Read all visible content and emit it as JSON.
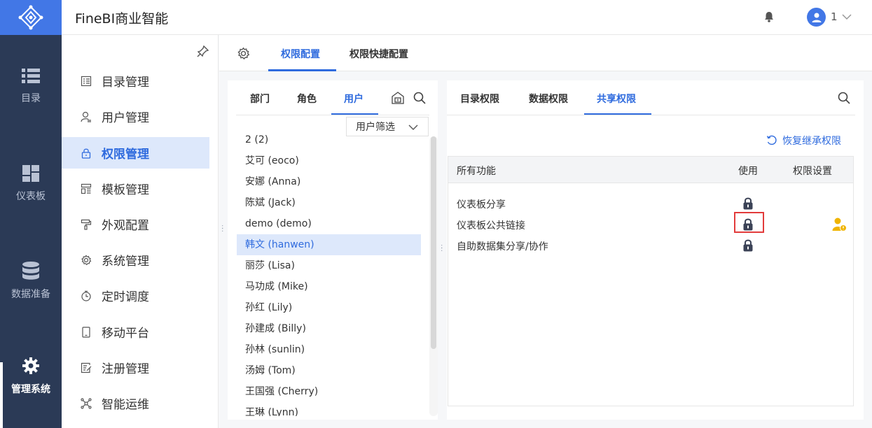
{
  "app": {
    "title": "FineBI商业智能",
    "user": "1"
  },
  "rail": [
    {
      "label": "目录",
      "icon": "list-icon"
    },
    {
      "label": "仪表板",
      "icon": "dashboard-icon"
    },
    {
      "label": "数据准备",
      "icon": "database-icon"
    },
    {
      "label": "管理系统",
      "icon": "gear-icon",
      "active": true
    }
  ],
  "menu": [
    {
      "label": "目录管理",
      "icon": "catalog-icon"
    },
    {
      "label": "用户管理",
      "icon": "user-icon"
    },
    {
      "label": "权限管理",
      "icon": "lock-icon",
      "active": true
    },
    {
      "label": "模板管理",
      "icon": "template-icon"
    },
    {
      "label": "外观配置",
      "icon": "paint-roller-icon"
    },
    {
      "label": "系统管理",
      "icon": "gear-icon"
    },
    {
      "label": "定时调度",
      "icon": "timer-icon"
    },
    {
      "label": "移动平台",
      "icon": "mobile-icon"
    },
    {
      "label": "注册管理",
      "icon": "register-icon"
    },
    {
      "label": "智能运维",
      "icon": "network-icon"
    }
  ],
  "main_tabs": [
    {
      "label": "权限配置",
      "active": true
    },
    {
      "label": "权限快捷配置"
    }
  ],
  "user_panel": {
    "tabs": [
      {
        "label": "部门"
      },
      {
        "label": "角色"
      },
      {
        "label": "用户",
        "active": true
      }
    ],
    "filter": "用户筛选",
    "users": [
      "2 (2)",
      "艾可 (eoco)",
      "安娜 (Anna)",
      "陈斌 (Jack)",
      "demo (demo)",
      "韩文 (hanwen)",
      "丽莎 (Lisa)",
      "马功成 (Mike)",
      "孙红 (Lily)",
      "孙建成 (Billy)",
      "孙林 (sunlin)",
      "汤姆 (Tom)",
      "王国强 (Cherry)",
      "王琳 (Lynn)"
    ],
    "selected_index": 5
  },
  "perm_panel": {
    "tabs": [
      {
        "label": "目录权限"
      },
      {
        "label": "数据权限"
      },
      {
        "label": "共享权限",
        "active": true
      }
    ],
    "restore": "恢复继承权限",
    "columns": [
      "所有功能",
      "使用",
      "权限设置"
    ],
    "rows": [
      {
        "name": "仪表板分享"
      },
      {
        "name": "仪表板公共链接",
        "highlighted": true,
        "has_setting": true
      },
      {
        "name": "自助数据集分享/协作"
      }
    ]
  },
  "colors": {
    "accent": "#2f6bde",
    "rail_bg": "#2b3a56",
    "highlight": "#e23b3b",
    "gold": "#f0b400"
  }
}
